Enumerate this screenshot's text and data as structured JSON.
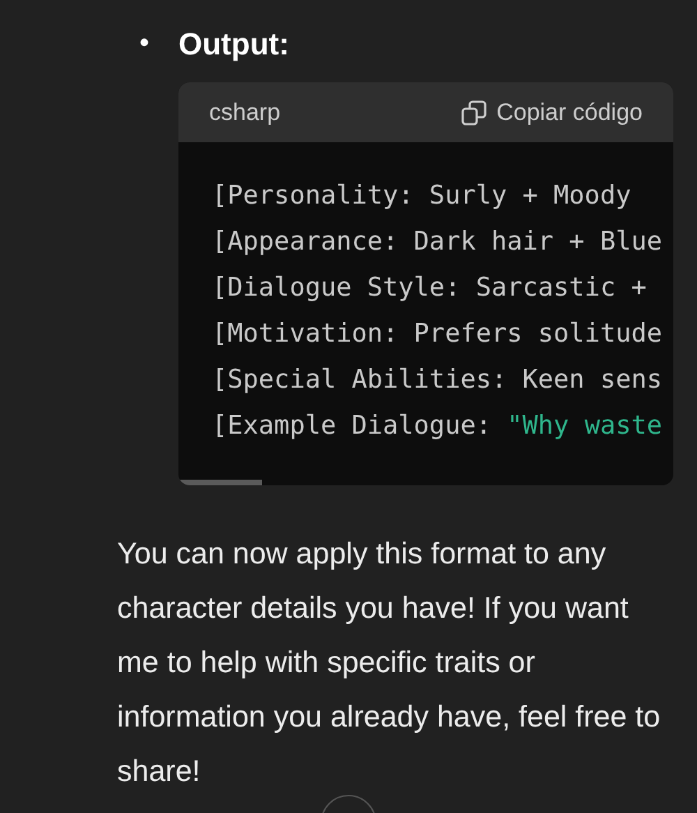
{
  "bullet": {
    "marker": "•",
    "label": "Output:"
  },
  "code_block": {
    "language": "csharp",
    "copy_button": "Copiar código",
    "lines": [
      [
        {
          "kind": "plain",
          "text": "[Personality: Surly + Moody"
        }
      ],
      [
        {
          "kind": "plain",
          "text": "[Appearance: Dark hair + Blue"
        }
      ],
      [
        {
          "kind": "plain",
          "text": "[Dialogue Style: Sarcastic +"
        }
      ],
      [
        {
          "kind": "plain",
          "text": "[Motivation: Prefers solitude"
        }
      ],
      [
        {
          "kind": "plain",
          "text": "[Special Abilities: Keen sens"
        }
      ],
      [
        {
          "kind": "plain",
          "text": "[Example Dialogue: "
        },
        {
          "kind": "string",
          "text": "\"Why waste"
        }
      ]
    ]
  },
  "message": "You can now apply this format to any character details you have! If you want me to help with specific traits or information you already have, feel free to share!"
}
